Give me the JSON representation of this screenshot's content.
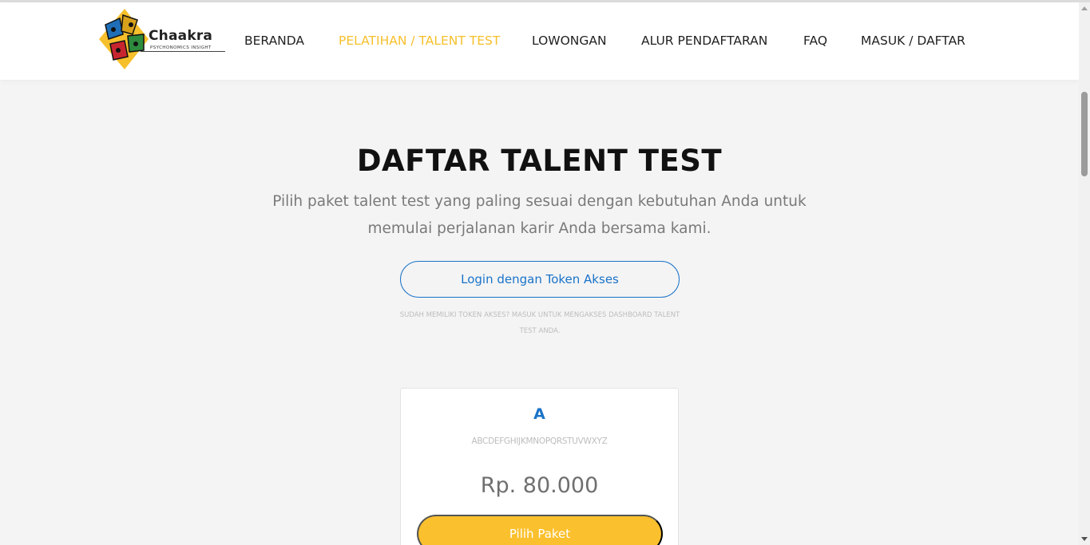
{
  "colors": {
    "accent_yellow": "#f6c02c",
    "button_yellow": "#fbc02d",
    "link_blue": "#1a73c9",
    "background": "#f4f4f4"
  },
  "header": {
    "logo": {
      "name": "Chaakra",
      "tagline": "PSYCHONOMICS INSIGHT"
    },
    "nav": [
      {
        "label": "BERANDA",
        "active": false
      },
      {
        "label": "PELATIHAN / TALENT TEST",
        "active": true
      },
      {
        "label": "LOWONGAN",
        "active": false
      },
      {
        "label": "ALUR PENDAFTARAN",
        "active": false
      },
      {
        "label": "FAQ",
        "active": false
      },
      {
        "label": "MASUK / DAFTAR",
        "active": false
      }
    ]
  },
  "hero": {
    "title": "DAFTAR TALENT TEST",
    "subtitle": "Pilih paket talent test yang paling sesuai dengan kebutuhan Anda untuk memulai perjalanan karir Anda bersama kami.",
    "token_button": "Login dengan Token Akses",
    "token_note": "Sudah memiliki token akses? Masuk untuk mengakses dashboard talent test Anda."
  },
  "packages": [
    {
      "name": "A",
      "description": "ABCDEFGHIJKMNOPQRSTUVWXYZ",
      "price": "Rp. 80.000",
      "button": "Pilih Paket"
    }
  ]
}
